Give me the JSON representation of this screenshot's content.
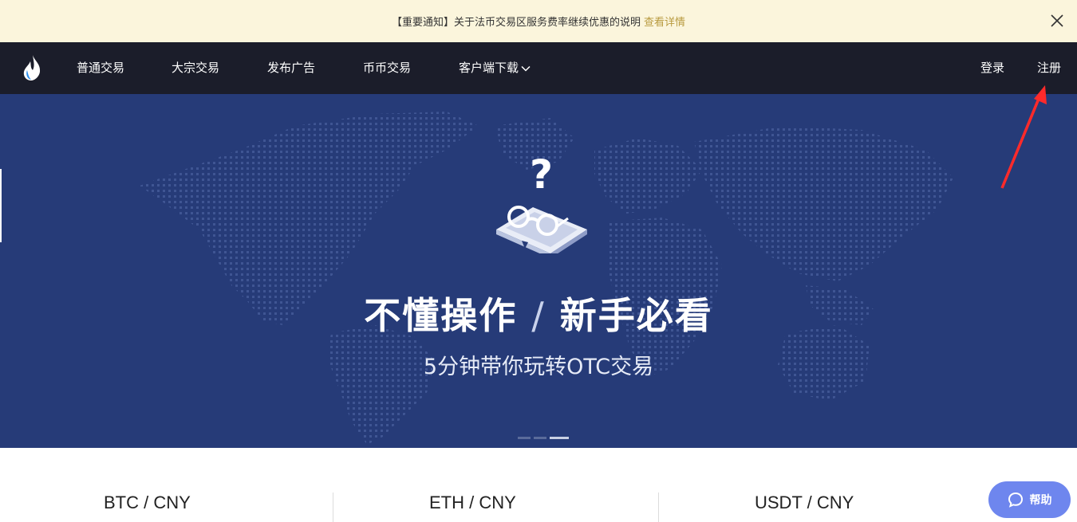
{
  "notice": {
    "text": "【重要通知】关于法币交易区服务费率继续优惠的说明",
    "link": "查看详情"
  },
  "nav": {
    "items": [
      "普通交易",
      "大宗交易",
      "发布广告",
      "币币交易",
      "客户端下载"
    ],
    "login": "登录",
    "register": "注册"
  },
  "banner": {
    "headline_left": "不懂操作",
    "slash": "/",
    "headline_right": "新手必看",
    "subtitle": "5分钟带你玩转OTC交易",
    "slide_count": 3,
    "active_slide": 3
  },
  "pairs": [
    "BTC / CNY",
    "ETH / CNY",
    "USDT / CNY"
  ],
  "help": {
    "label": "帮助"
  },
  "icons": {
    "logo": "flame-logo-icon",
    "close": "close-icon",
    "chevron": "chevron-down-icon",
    "help": "chat-bubble-icon",
    "illustration": "question-mark-glasses-book-icon"
  },
  "colors": {
    "notice_bg": "#fbf5dc",
    "notice_link": "#b89a3f",
    "nav_bg": "#1b1d2a",
    "banner_bg": "#263b78",
    "help_bg": "#6e86ee",
    "annotation_arrow": "#ff2a2a"
  }
}
